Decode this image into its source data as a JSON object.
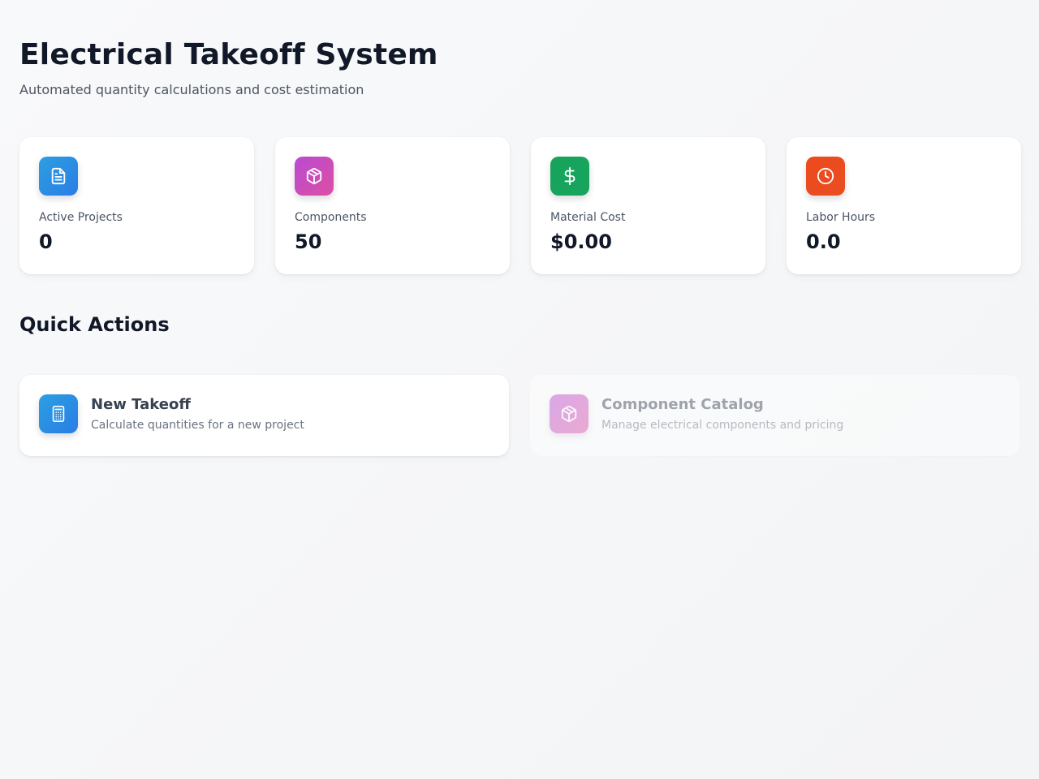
{
  "header": {
    "title": "Electrical Takeoff System",
    "subtitle": "Automated quantity calculations and cost estimation"
  },
  "stats": [
    {
      "label": "Active Projects",
      "value": "0",
      "icon": "document-icon",
      "color": "#2b8fe3"
    },
    {
      "label": "Components",
      "value": "50",
      "icon": "package-icon",
      "color": "#c84cc0"
    },
    {
      "label": "Material Cost",
      "value": "$0.00",
      "icon": "dollar-icon",
      "color": "#16a35a"
    },
    {
      "label": "Labor Hours",
      "value": "0.0",
      "icon": "clock-icon",
      "color": "#ea4b1e"
    }
  ],
  "quick_actions": {
    "title": "Quick Actions",
    "items": [
      {
        "title": "New Takeoff",
        "description": "Calculate quantities for a new project",
        "icon": "calculator-icon",
        "color": "#2b8fe3"
      },
      {
        "title": "Component Catalog",
        "description": "Manage electrical components and pricing",
        "icon": "package-icon",
        "color": "#c84cc0"
      }
    ]
  }
}
